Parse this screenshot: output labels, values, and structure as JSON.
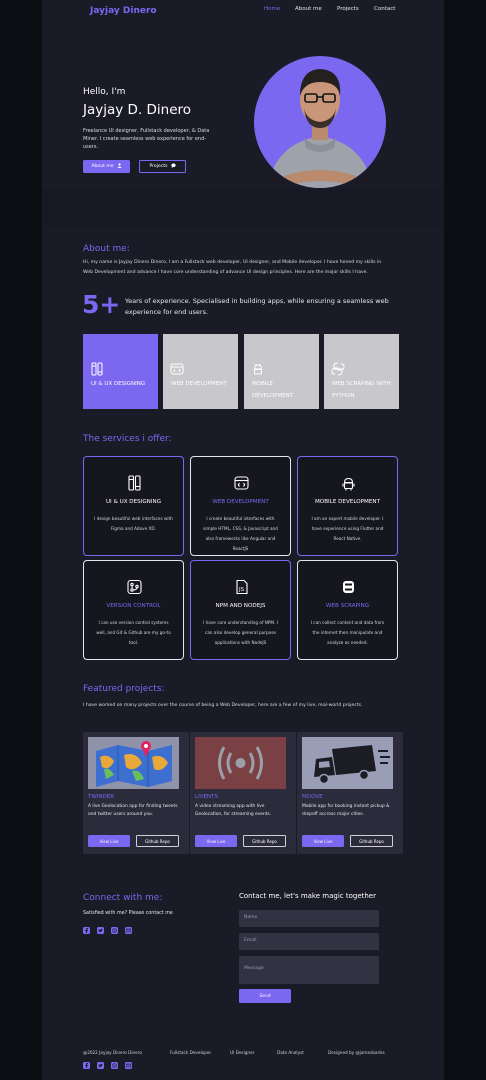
{
  "nav": {
    "brand": "Jayjay Dinero",
    "links": [
      "Home",
      "About me",
      "Projects",
      "Contact"
    ]
  },
  "hero": {
    "greeting": "Hello, I'm",
    "name": "Jayjay D. Dinero",
    "tagline": "Freelance UI designer, Fullstack developer, & Data Miner. I create seamless web experience for end-users.",
    "about_button": "About me",
    "projects_button": "Projects"
  },
  "about": {
    "title": "About me:",
    "text": "Hi, my name is Jayjay Dinero Dinero, I am a Fullstack web developer, UI designer, and Mobile developer. I have honed my skills in Web Development and advance I have core understanding of advance UI design principles. Here are the major skills I have.",
    "years_number": "5+",
    "years_text": "Years of experience. Specialised in building apps, while ensuring a seamless web experience for end users.",
    "skills": [
      {
        "label": "UI & UX DESIGNING",
        "icon": "pen-tool-icon"
      },
      {
        "label": "WEB DEVELOPMENT",
        "icon": "browser-code-icon"
      },
      {
        "label": "MOBILE DEVELOPMENT",
        "icon": "android-icon"
      },
      {
        "label": "WEB SCRAPING WITH PYTHON",
        "icon": "python-icon"
      }
    ]
  },
  "services": {
    "title": "The services i offer:",
    "items": [
      {
        "title": "UI & UX DESIGNING",
        "desc": "I design beautiful web interfaces with Figma and Adove XD.",
        "icon": "pen-tool-icon"
      },
      {
        "title": "WEB DEVELOPMENT",
        "desc": "I create beautiful interfaces with simple HTML, CSS, & Javascript and also frameworks like Angular and ReactJS",
        "icon": "browser-code-icon"
      },
      {
        "title": "MOBILE DEVELOPMENT",
        "desc": "I am an expert mobile developer. I have experience using Flutter and React Native.",
        "icon": "android-icon"
      },
      {
        "title": "VERSION CONTROL",
        "desc": "I can use version control systems well, and Git & Github are my go-to tool.",
        "icon": "git-icon"
      },
      {
        "title": "NPM AND NODEJS",
        "desc": "I have core understanding of NPM. I can also develop general purpose applications with NodeJS",
        "icon": "npm-icon"
      },
      {
        "title": "WEB SCRAPING",
        "desc": "I can collect content and data from the internet then manipulate and analyze as needed.",
        "icon": "python-icon"
      }
    ]
  },
  "projects": {
    "title": "Featured projects:",
    "text": "I have worked on many projects over the course of being a Web Developer, here are a few of my live, real-world projects.",
    "items": [
      {
        "title": "TWINDER",
        "desc": "A live Geolocation app for finding tweets and twitter users around you.",
        "live": "View Live",
        "repo": "Github Repo",
        "image": "map-pin-image"
      },
      {
        "title": "LIVENTS",
        "desc": "A video streaming app with live Geolocation, for streaming events.",
        "live": "View Live",
        "repo": "Github Repo",
        "image": "broadcast-image"
      },
      {
        "title": "MOOVE",
        "desc": "Mobile app for booking instant pickup & dropoff accross major cities.",
        "live": "View Live",
        "repo": "Github Repo",
        "image": "truck-image"
      }
    ]
  },
  "connect": {
    "title": "Connect with me:",
    "sub": "Satisfied with me? Please contact me",
    "social": [
      "facebook-icon",
      "twitter-icon",
      "dribbble-icon",
      "mail-icon"
    ],
    "magic": "Contact me, let's make magic together",
    "name_placeholder": "Name",
    "email_placeholder": "Email",
    "message_placeholder": "Message",
    "send": "Send"
  },
  "footer": {
    "copyright": "@2022 Jayjay Dinero Dinero",
    "role1": "Fullstack Developer",
    "role2": "UI Designer",
    "role3": "Data Analyst",
    "credit": "Designed by @jamesbanks"
  },
  "colors": {
    "accent": "#7c67f0",
    "background": "#1b1b27",
    "skill_gray": "#c8c8cc"
  }
}
